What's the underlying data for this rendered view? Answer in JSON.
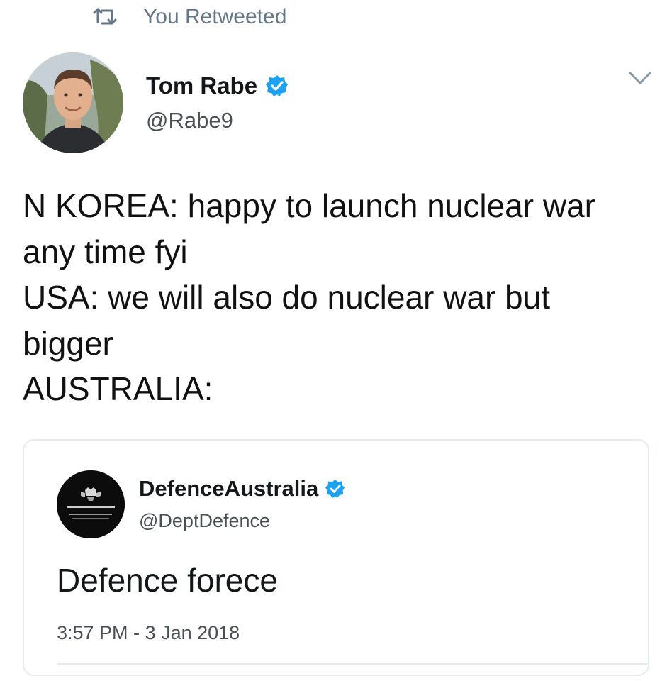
{
  "retweet": {
    "label": "You Retweeted",
    "icon": "retweet-icon"
  },
  "author": {
    "name": "Tom Rabe",
    "handle": "@Rabe9",
    "verified_icon": "verified-badge-icon",
    "avatar_icon": "avatar-photo"
  },
  "menu": {
    "icon": "chevron-down-icon"
  },
  "tweet": {
    "lines": [
      "N KOREA: happy to launch nuclear war",
      "any time fyi",
      "USA: we will also do nuclear war but",
      "bigger",
      "AUSTRALIA:"
    ]
  },
  "quote": {
    "name": "DefenceAustralia",
    "handle": "@DeptDefence",
    "verified_icon": "verified-badge-icon",
    "avatar_icon": "australian-government-crest",
    "text": "Defence forece",
    "timestamp": "3:57 PM - 3 Jan 2018"
  },
  "colors": {
    "text": "#14171a",
    "secondary": "#657786",
    "verified": "#1da1f2",
    "border": "#e6ecf0"
  }
}
